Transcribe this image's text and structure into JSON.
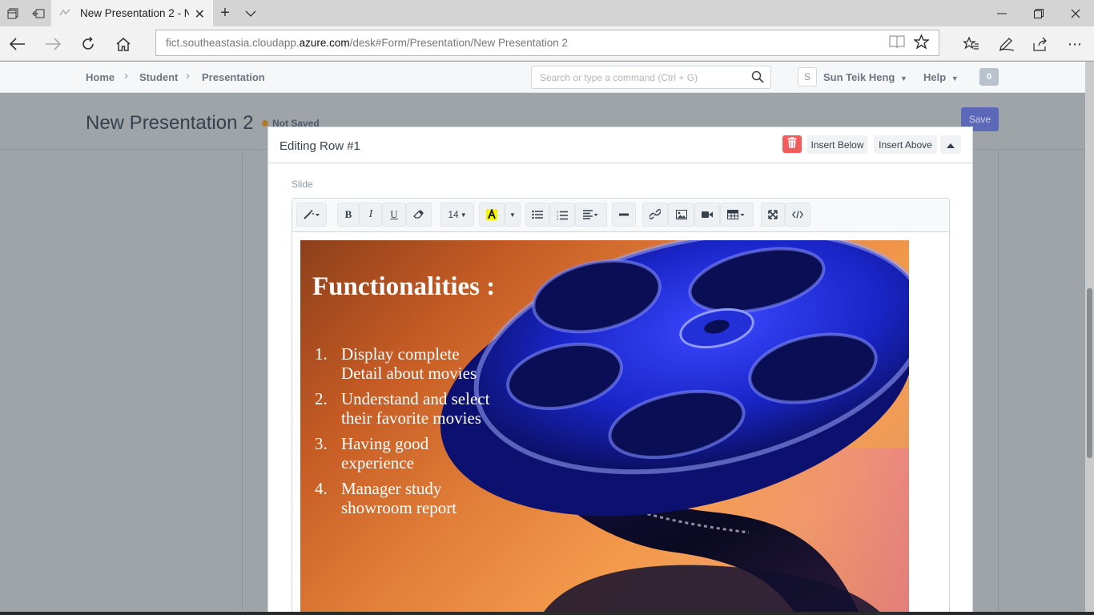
{
  "browser": {
    "tab_title": "New Presentation 2 - N",
    "url_prefix": "fict.southeastasia.cloudapp.",
    "url_domain": "azure.com",
    "url_path": "/desk#Form/Presentation/New Presentation 2"
  },
  "header": {
    "breadcrumbs": [
      "Home",
      "Student",
      "Presentation"
    ],
    "search_placeholder": "Search or type a command (Ctrl + G)",
    "avatar_letter": "S",
    "user_name": "Sun Teik Heng",
    "help_label": "Help",
    "notification_count": "0"
  },
  "page": {
    "title": "New Presentation 2",
    "status": "Not Saved",
    "save_label": "Save"
  },
  "panel": {
    "title": "Editing Row #1",
    "insert_below": "Insert Below",
    "insert_above": "Insert Above",
    "field_label": "Slide"
  },
  "toolbar": {
    "font_size": "14"
  },
  "slide": {
    "title": "Functionalities :",
    "items": [
      {
        "num": "1.",
        "text": "Display complete Detail about movies"
      },
      {
        "num": "2.",
        "text": "Understand and select their favorite movies"
      },
      {
        "num": "3.",
        "text": "Having good experience"
      },
      {
        "num": "4.",
        "text": "Manager study showroom report"
      }
    ]
  },
  "colors": {
    "save_button": "#5b69b8",
    "delete_button": "#f35b5b",
    "not_saved_dot": "#b07b2a",
    "reel_blue": "#1a25c8"
  }
}
